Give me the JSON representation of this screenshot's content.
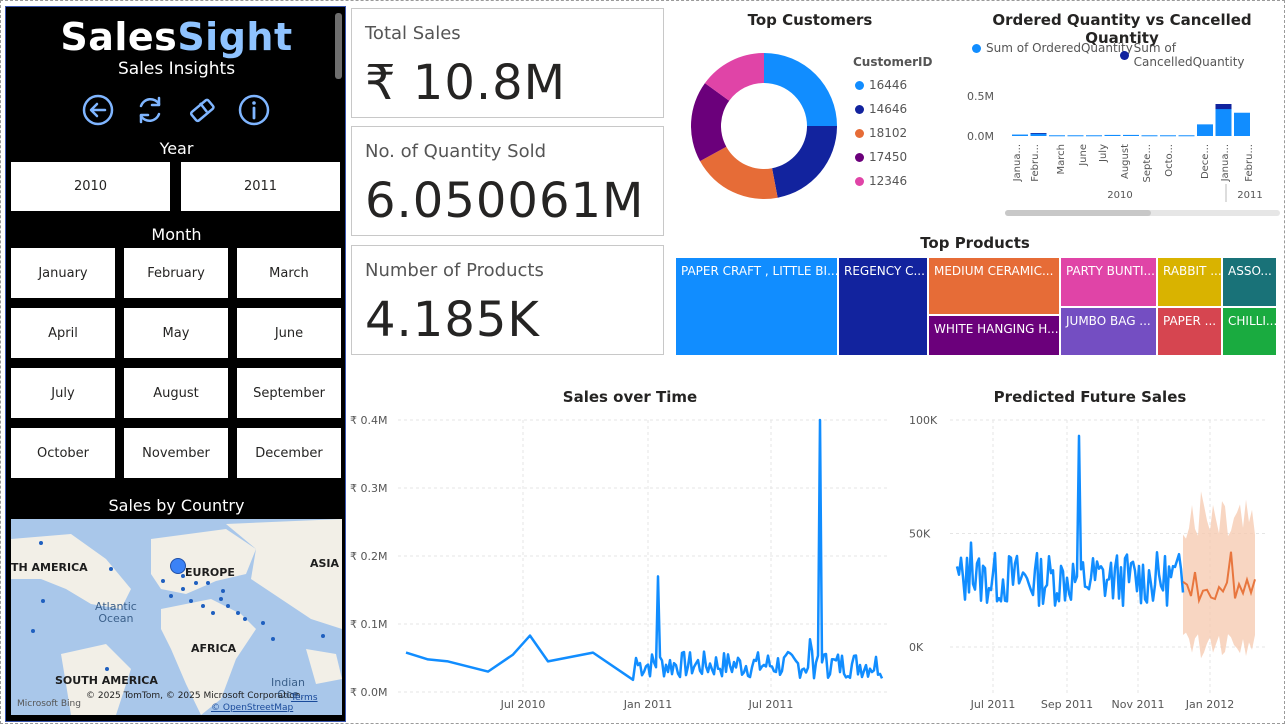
{
  "brand": {
    "part1": "Sales",
    "part2": "Sight"
  },
  "subtitle": "Sales Insights",
  "nav_icons": [
    "back-icon",
    "refresh-icon",
    "eraser-icon",
    "info-icon"
  ],
  "year_section": {
    "title": "Year",
    "options": [
      "2010",
      "2011"
    ]
  },
  "month_section": {
    "title": "Month",
    "options": [
      "January",
      "February",
      "March",
      "April",
      "May",
      "June",
      "July",
      "August",
      "September",
      "October",
      "November",
      "December"
    ]
  },
  "map_section": {
    "title": "Sales by Country",
    "labels": {
      "north_america": "TH AMERICA",
      "europe": "EUROPE",
      "asia": "ASIA",
      "africa": "AFRICA",
      "south_america": "SOUTH AMERICA",
      "indian": "Indian",
      "atlantic": "Atlantic",
      "ocean": "Ocean",
      "oce": "Oce"
    },
    "attribution": "© 2025 TomTom, © 2025 Microsoft Corporation,",
    "terms": "Terms",
    "osm": "© OpenStreetMap",
    "bing": "Microsoft Bing"
  },
  "cards": [
    {
      "title": "Total Sales",
      "value": "₹ 10.8M"
    },
    {
      "title": "No. of Quantity Sold",
      "value": "6.050061M"
    },
    {
      "title": "Number of Products",
      "value": "4.185K"
    }
  ],
  "colors": {
    "blue": "#118DFF",
    "navy": "#12239E",
    "orange": "#E66C37",
    "purple": "#6B007B",
    "pink": "#E044A7",
    "forecast": "#E8763E"
  },
  "chart_data": [
    {
      "type": "pie",
      "title": "Top Customers",
      "legend_title": "CustomerID",
      "categories": [
        "16446",
        "14646",
        "18102",
        "17450",
        "12346"
      ],
      "values": [
        25,
        22,
        20,
        18,
        15
      ]
    },
    {
      "type": "bar",
      "title": "Ordered Quantity vs Cancelled Quantity",
      "series": [
        {
          "name": "Sum of OrderedQuantity",
          "values": [
            0.02,
            0.04,
            0.01,
            0.01,
            0.01,
            0.015,
            0.015,
            0.01,
            0.01,
            0.01,
            0.16,
            0.44,
            0.32
          ]
        },
        {
          "name": "Sum of CancelledQuantity",
          "values": [
            0,
            0.01,
            0,
            0,
            0,
            0,
            0,
            0,
            0,
            0,
            0,
            0.07,
            0
          ]
        }
      ],
      "categories": [
        "Janua...",
        "Febru...",
        "March",
        "June",
        "July",
        "August",
        "Septe...",
        "Octo...",
        "Dece...",
        "Janua...",
        "Febru..."
      ],
      "groups": [
        "2010",
        "2011"
      ],
      "yticks": [
        "0.5M",
        "0.0M"
      ],
      "ylim": [
        0,
        0.55
      ]
    },
    {
      "type": "heatmap",
      "title": "Top Products",
      "categories": [
        "PAPER CRAFT , LITTLE BI...",
        "REGENCY C...",
        "MEDIUM CERAMIC...",
        "WHITE HANGING H...",
        "PARTY BUNTI...",
        "JUMBO BAG ...",
        "RABBIT ...",
        "PAPER ...",
        "ASSO...",
        "CHILLI..."
      ]
    },
    {
      "type": "line",
      "title": "Sales over Time",
      "yticks": [
        "₹ 0.4M",
        "₹ 0.3M",
        "₹ 0.2M",
        "₹ 0.1M",
        "₹ 0.0M"
      ],
      "xticks": [
        "Jul 2010",
        "Jan 2011",
        "Jul 2011"
      ],
      "ylim": [
        0,
        0.4
      ],
      "annotations": {
        "peak_value": 0.37,
        "second_peak": 0.17
      }
    },
    {
      "type": "line",
      "title": "Predicted Future Sales",
      "yticks": [
        "100K",
        "50K",
        "0K"
      ],
      "xticks": [
        "Jul 2011",
        "Sep 2011",
        "Nov 2011",
        "Jan 2012"
      ],
      "ylim": [
        0,
        100
      ],
      "annotations": {
        "peak_value": 93
      }
    }
  ]
}
